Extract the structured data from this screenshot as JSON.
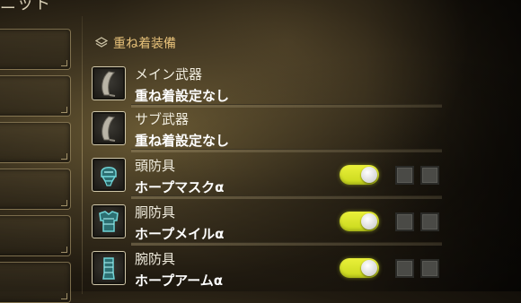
{
  "screen": {
    "title_partial": "ニット"
  },
  "section": {
    "header": "重ね着装備"
  },
  "rows": [
    {
      "category": "メイン武器",
      "item": "重ね着設定なし",
      "icon": "great-sword-icon",
      "toggle": null
    },
    {
      "category": "サブ武器",
      "item": "重ね着設定なし",
      "icon": "great-sword-icon",
      "toggle": null
    },
    {
      "category": "頭防具",
      "item": "ホープマスクα",
      "icon": "helmet-icon",
      "toggle": true
    },
    {
      "category": "胴防具",
      "item": "ホープメイルα",
      "icon": "chest-armor-icon",
      "toggle": true
    },
    {
      "category": "腕防具",
      "item": "ホープアームα",
      "icon": "gauntlet-icon",
      "toggle": true
    }
  ],
  "colors": {
    "header": "#e8c27a",
    "toggle_on": "#dde82a",
    "armor_icon": "#5ec7c9"
  }
}
